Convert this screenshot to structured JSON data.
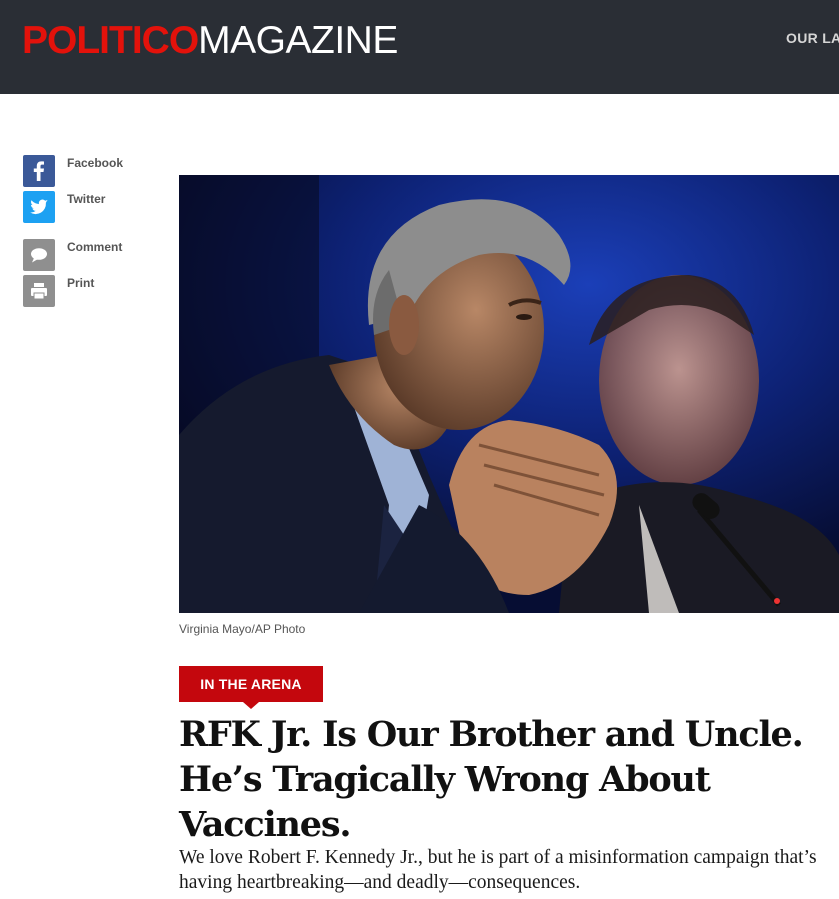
{
  "header": {
    "logo_politico": "POLITICO",
    "logo_magazine": "MAGAZINE",
    "nav_latest": "OUR LAT"
  },
  "share": {
    "facebook": "Facebook",
    "twitter": "Twitter",
    "comment": "Comment",
    "print": "Print"
  },
  "article": {
    "photo_credit": "Virginia Mayo/AP Photo",
    "category": "IN THE ARENA",
    "headline": "RFK Jr. Is Our Brother and Uncle. He’s Tragically Wrong About Vaccines.",
    "dek": "We love Robert F. Kennedy Jr., but he is part of a misinformation campaign that’s having heartbreaking—and deadly—consequences."
  },
  "colors": {
    "header_bg": "#2a2e35",
    "brand_red": "#e3120b",
    "tag_red": "#c4070d",
    "facebook_blue": "#3b5998",
    "twitter_blue": "#1da1f2"
  },
  "icons": [
    "facebook-icon",
    "twitter-icon",
    "comment-icon",
    "print-icon"
  ]
}
